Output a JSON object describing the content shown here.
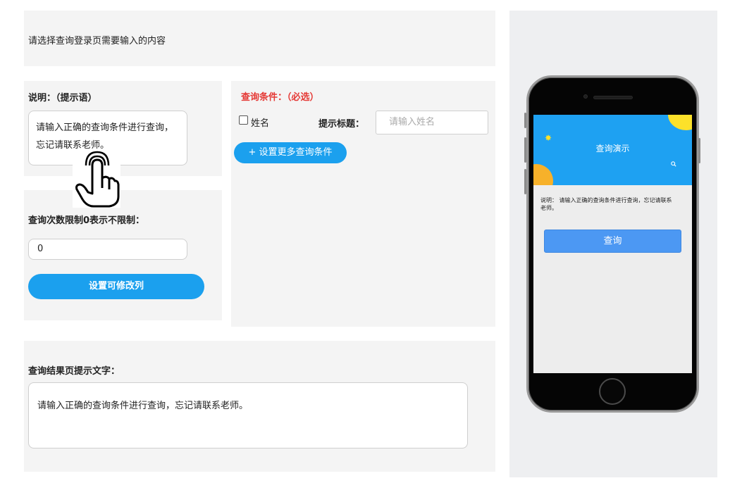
{
  "top_panel": {
    "label": "请选择查询登录页需要输入的内容"
  },
  "description_panel": {
    "title": "说明：（提示语）",
    "text": "请输入正确的查询条件进行查询，忘记请联系老师。"
  },
  "limit_panel": {
    "title": "查询次数限制0表示不限制：",
    "value": "0",
    "button_label": "设置可修改列"
  },
  "condition_panel": {
    "title": "查询条件：（必选）",
    "checkbox_label": "姓名",
    "checked": false,
    "hint_label": "提示标题：",
    "name_placeholder": "请输入姓名",
    "more_button_label": "+ 设置更多查询条件"
  },
  "result_panel": {
    "title": "查询结果页提示文字：",
    "text": "请输入正确的查询条件进行查询，忘记请联系老师。"
  },
  "phone_preview": {
    "header_title": "查询演示",
    "description": "说明： 请输入正确的查询条件进行查询，忘记请联系老师。",
    "query_button_label": "查询",
    "colors": {
      "header": "#1ea1f2",
      "button": "#4c98f3",
      "sun": "#fce12a",
      "orange": "#f7b12a"
    }
  },
  "icons": [
    "hand-pointer-icon",
    "star-icon",
    "search-icon"
  ]
}
